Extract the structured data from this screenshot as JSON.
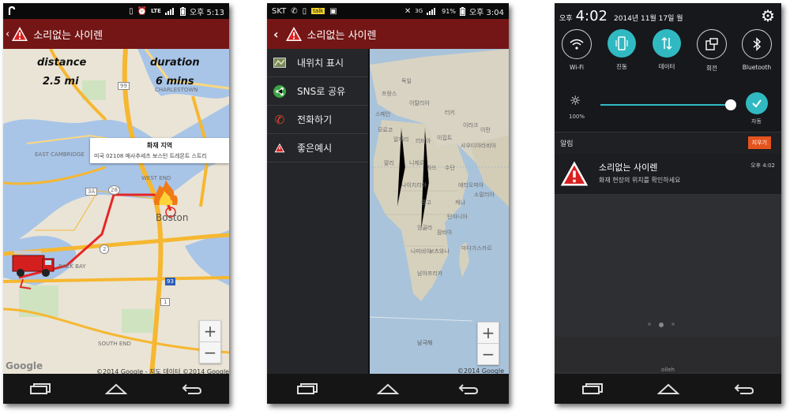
{
  "app": {
    "title": "소리없는 사이렌",
    "brand_color": "#741616",
    "icon": "warning-triangle-icon"
  },
  "screen1": {
    "status": {
      "carrier_icon": "carrier-logo-icon",
      "network": "LTE",
      "time": "오후 5:13"
    },
    "info": {
      "distance_label": "distance",
      "distance_value": "2.5 mi",
      "duration_label": "duration",
      "duration_value": "6 mins"
    },
    "popup": {
      "title": "화재 지역",
      "address": "미국 02108 매사추세츠 보스턴 트레몬트 스트리"
    },
    "map_labels": {
      "boston": "Boston",
      "charlestown": "CHARLESTOWN",
      "east_cambridge": "EAST CAMBRIDGE",
      "back_bay": "BACK BAY",
      "south_end": "SOUTH END",
      "west_end": "WEST END",
      "route_3a": "3A",
      "route_28": "28",
      "route_99": "99",
      "route_2": "2",
      "route_93": "93",
      "route_1": "1"
    },
    "zoom": {
      "in": "+",
      "out": "−"
    },
    "copyright": "©2014 Google - 지도 데이터 ©2014 Google",
    "google": "Google"
  },
  "screen2": {
    "status": {
      "carrier": "SKT",
      "network": "3G",
      "battery": "91%",
      "time": "오후 3:04"
    },
    "menu": [
      {
        "label": "내위치 표시",
        "icon": "map-icon"
      },
      {
        "label": "SNS로 공유",
        "icon": "share-icon"
      },
      {
        "label": "전화하기",
        "icon": "phone-icon"
      },
      {
        "label": "좋은예시",
        "icon": "warning-icon"
      }
    ],
    "map_labels": {
      "l1": "알제리",
      "l2": "리비아",
      "l3": "이집트",
      "l4": "말리",
      "l5": "니제르",
      "l6": "차드",
      "l7": "수단",
      "l8": "나이지리아",
      "l9": "에티오피아",
      "l10": "콩고",
      "l11": "케냐",
      "l12": "탄자니아",
      "l13": "앙골라",
      "l14": "잠비아",
      "l15": "나미비아",
      "l16": "보츠와나",
      "l17": "남아프리카",
      "l18": "마다가스카르",
      "l19": "사우디아라비아",
      "l20": "이란",
      "l21": "독일",
      "l22": "프랑스",
      "l23": "스페인",
      "l24": "이탈리아",
      "l25": "터키",
      "l26": "이라크",
      "l27": "남극해",
      "l28": "모로코",
      "l29": "소말리아"
    },
    "zoom": {
      "in": "+",
      "out": "−"
    },
    "copyright": "©2014 Google"
  },
  "screen3": {
    "status": {
      "ampm": "오후",
      "time": "4:02",
      "date": "2014년 11월 17일 월"
    },
    "toggles": [
      {
        "label": "Wi-Fi",
        "icon": "wifi-icon",
        "on": false
      },
      {
        "label": "진동",
        "icon": "vibrate-icon",
        "on": true
      },
      {
        "label": "데이터",
        "icon": "data-icon",
        "on": true
      },
      {
        "label": "회전",
        "icon": "rotate-icon",
        "on": false
      },
      {
        "label": "Bluetooth",
        "icon": "bluetooth-icon",
        "on": false
      }
    ],
    "brightness": {
      "percent_label": "100%",
      "auto_label": "자동",
      "level": 0.97
    },
    "notifications_header": "알림",
    "clear_button": "지우기",
    "notification": {
      "title": "소리없는 사이렌",
      "body": "화재 현장의 위치를 확인하세요",
      "time": "오후 4:02"
    },
    "carrier": "olleh",
    "accent": "#31b9c2"
  }
}
